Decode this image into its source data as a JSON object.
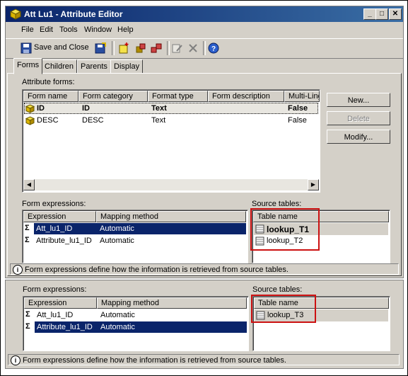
{
  "window": {
    "title": "Att Lu1 - Attribute Editor",
    "min": "_",
    "max": "□",
    "close": "✕"
  },
  "menu": [
    "File",
    "Edit",
    "Tools",
    "Window",
    "Help"
  ],
  "toolbar": {
    "save_close_label": "Save and Close"
  },
  "tabs": [
    "Forms",
    "Children",
    "Parents",
    "Display"
  ],
  "forms": {
    "label": "Attribute forms:",
    "columns": [
      "Form name",
      "Form category",
      "Format type",
      "Form description",
      "Multi-Ling"
    ],
    "rows": [
      {
        "name": "ID",
        "category": "ID",
        "format": "Text",
        "desc": "",
        "multi": "False"
      },
      {
        "name": "DESC",
        "category": "DESC",
        "format": "Text",
        "desc": "",
        "multi": "False"
      }
    ],
    "buttons": {
      "new": "New...",
      "delete": "Delete",
      "modify": "Modify..."
    }
  },
  "expressions_top": {
    "label": "Form expressions:",
    "columns": [
      "Expression",
      "Mapping method"
    ],
    "rows": [
      {
        "expr": "Att_lu1_ID",
        "method": "Automatic"
      },
      {
        "expr": "Attribute_lu1_ID",
        "method": "Automatic"
      }
    ]
  },
  "source_top": {
    "label": "Source tables:",
    "column": "Table name",
    "rows": [
      "lookup_T1",
      "lookup_T2"
    ]
  },
  "status_text": "Form expressions define how the information is retrieved from source tables.",
  "expressions_bottom": {
    "label": "Form expressions:",
    "columns": [
      "Expression",
      "Mapping method"
    ],
    "rows": [
      {
        "expr": "Att_lu1_ID",
        "method": "Automatic"
      },
      {
        "expr": "Attribute_lu1_ID",
        "method": "Automatic"
      }
    ]
  },
  "source_bottom": {
    "label": "Source tables:",
    "column": "Table name",
    "rows": [
      "lookup_T3"
    ]
  },
  "colors": {
    "title_start": "#0a246a",
    "title_end": "#3a6ea5",
    "selection": "#0a246a",
    "highlight_box": "#cc1111",
    "face": "#d4d0c8"
  }
}
